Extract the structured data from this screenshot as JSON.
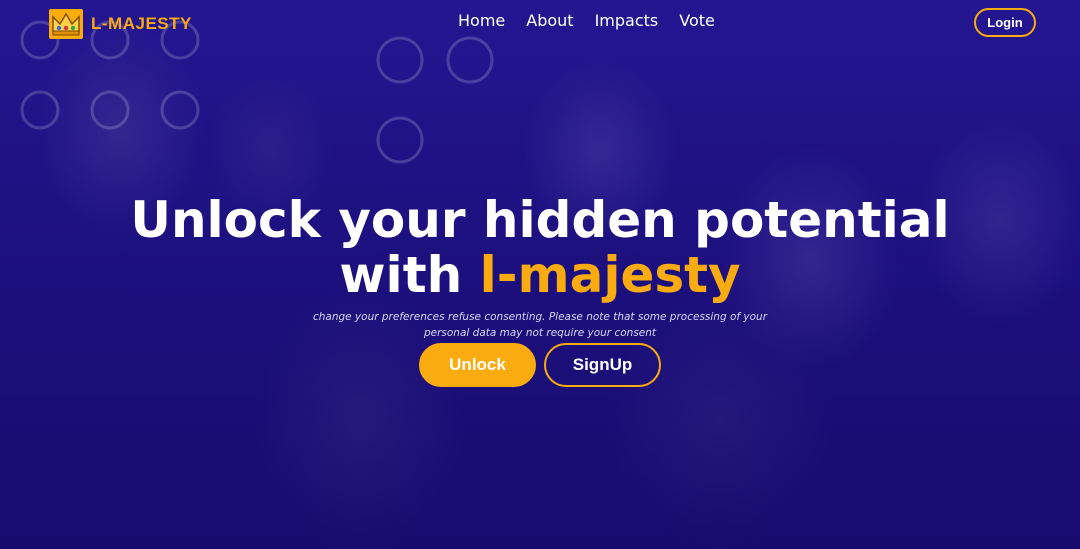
{
  "header": {
    "logo_text": "L-MAJESTY",
    "logo_icon": "crown-icon",
    "nav": [
      {
        "label": "Home"
      },
      {
        "label": "About"
      },
      {
        "label": "Impacts"
      },
      {
        "label": "Vote"
      }
    ],
    "login_label": "Login"
  },
  "hero": {
    "headline_line1": "Unlock your hidden potential",
    "headline_line2_prefix": "with ",
    "headline_brand": "l-majesty",
    "subtext": "change your preferences refuse consenting. Please note that some processing of your personal data may not require your consent",
    "unlock_label": "Unlock",
    "signup_label": "SignUp"
  },
  "colors": {
    "accent": "#f9ab10",
    "background": "#1c0f7a",
    "text": "#ffffff"
  }
}
